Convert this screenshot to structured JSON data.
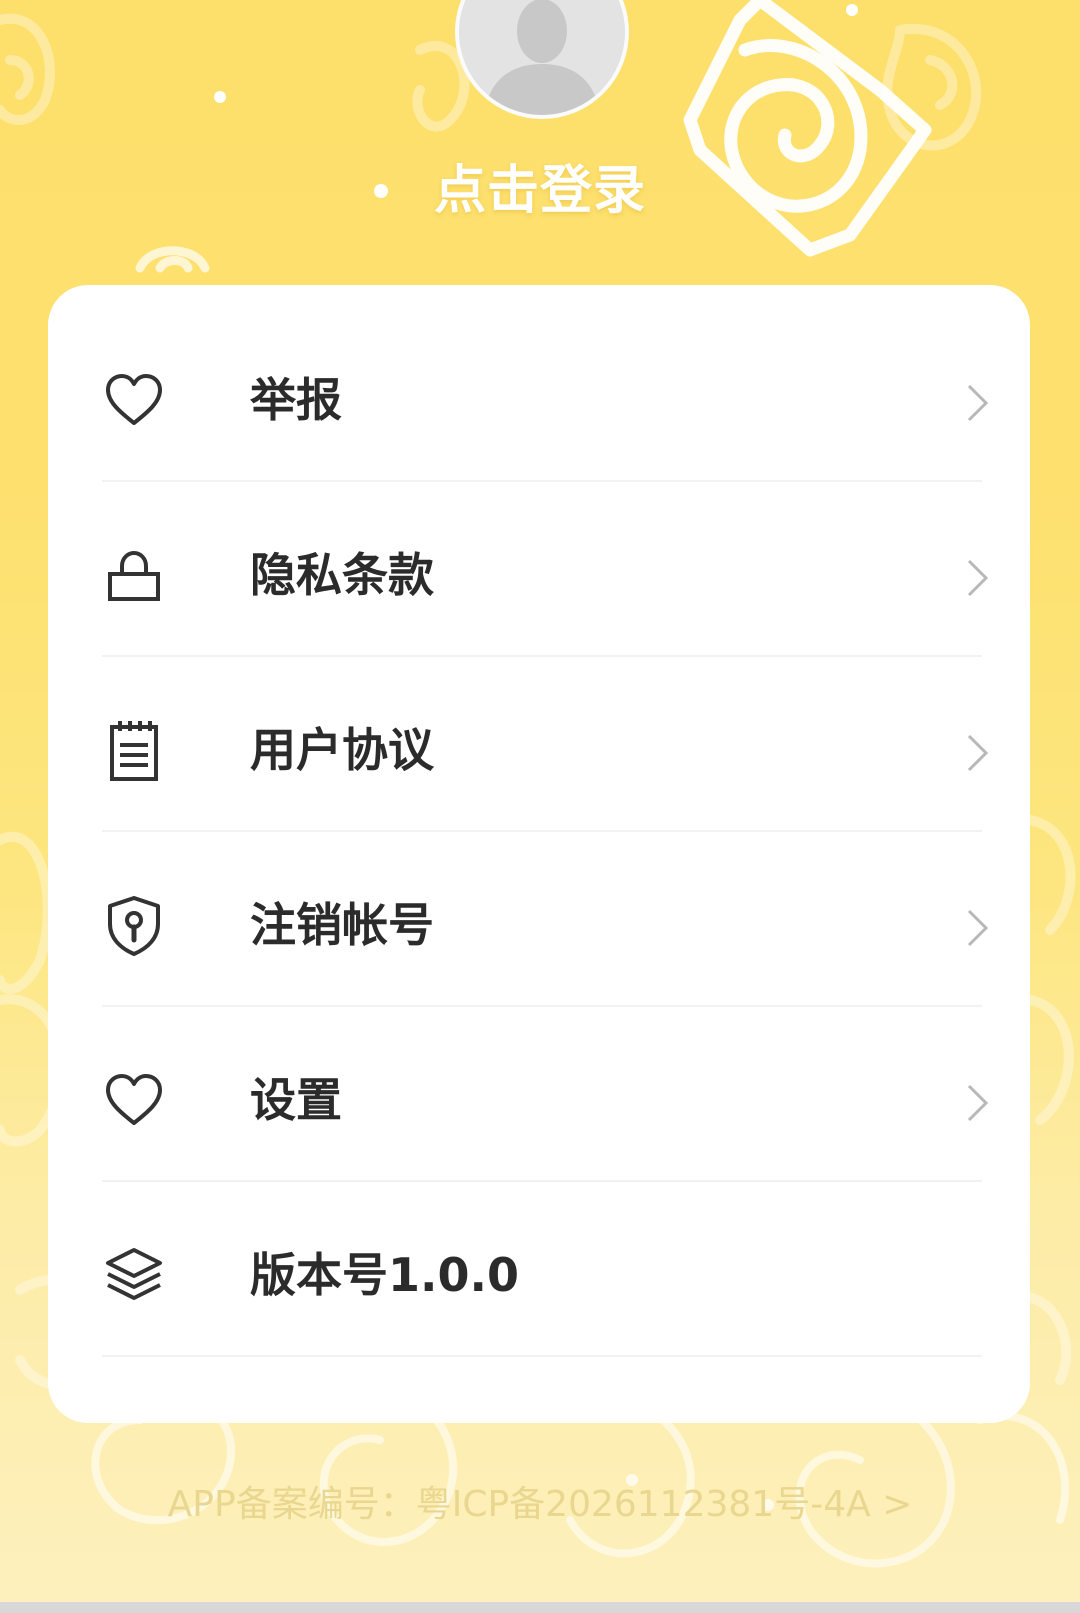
{
  "header": {
    "login_label": "点击登录"
  },
  "menu": {
    "items": [
      {
        "label": "举报",
        "icon": "heart-icon"
      },
      {
        "label": "隐私条款",
        "icon": "lock-icon"
      },
      {
        "label": "用户协议",
        "icon": "notepad-icon"
      },
      {
        "label": "注销帐号",
        "icon": "shield-keyhole-icon"
      },
      {
        "label": "设置",
        "icon": "heart-icon"
      },
      {
        "label": "版本号1.0.0",
        "icon": "layers-icon"
      }
    ]
  },
  "footer": {
    "icp_text": "APP备案编号：粤ICP备2026112381号-4A >"
  },
  "colors": {
    "background_top": "#fddf6c",
    "background_bottom": "#fdf0bd",
    "card": "#ffffff",
    "label_text": "#2b2b2b",
    "footer_text": "#e9d68f"
  }
}
